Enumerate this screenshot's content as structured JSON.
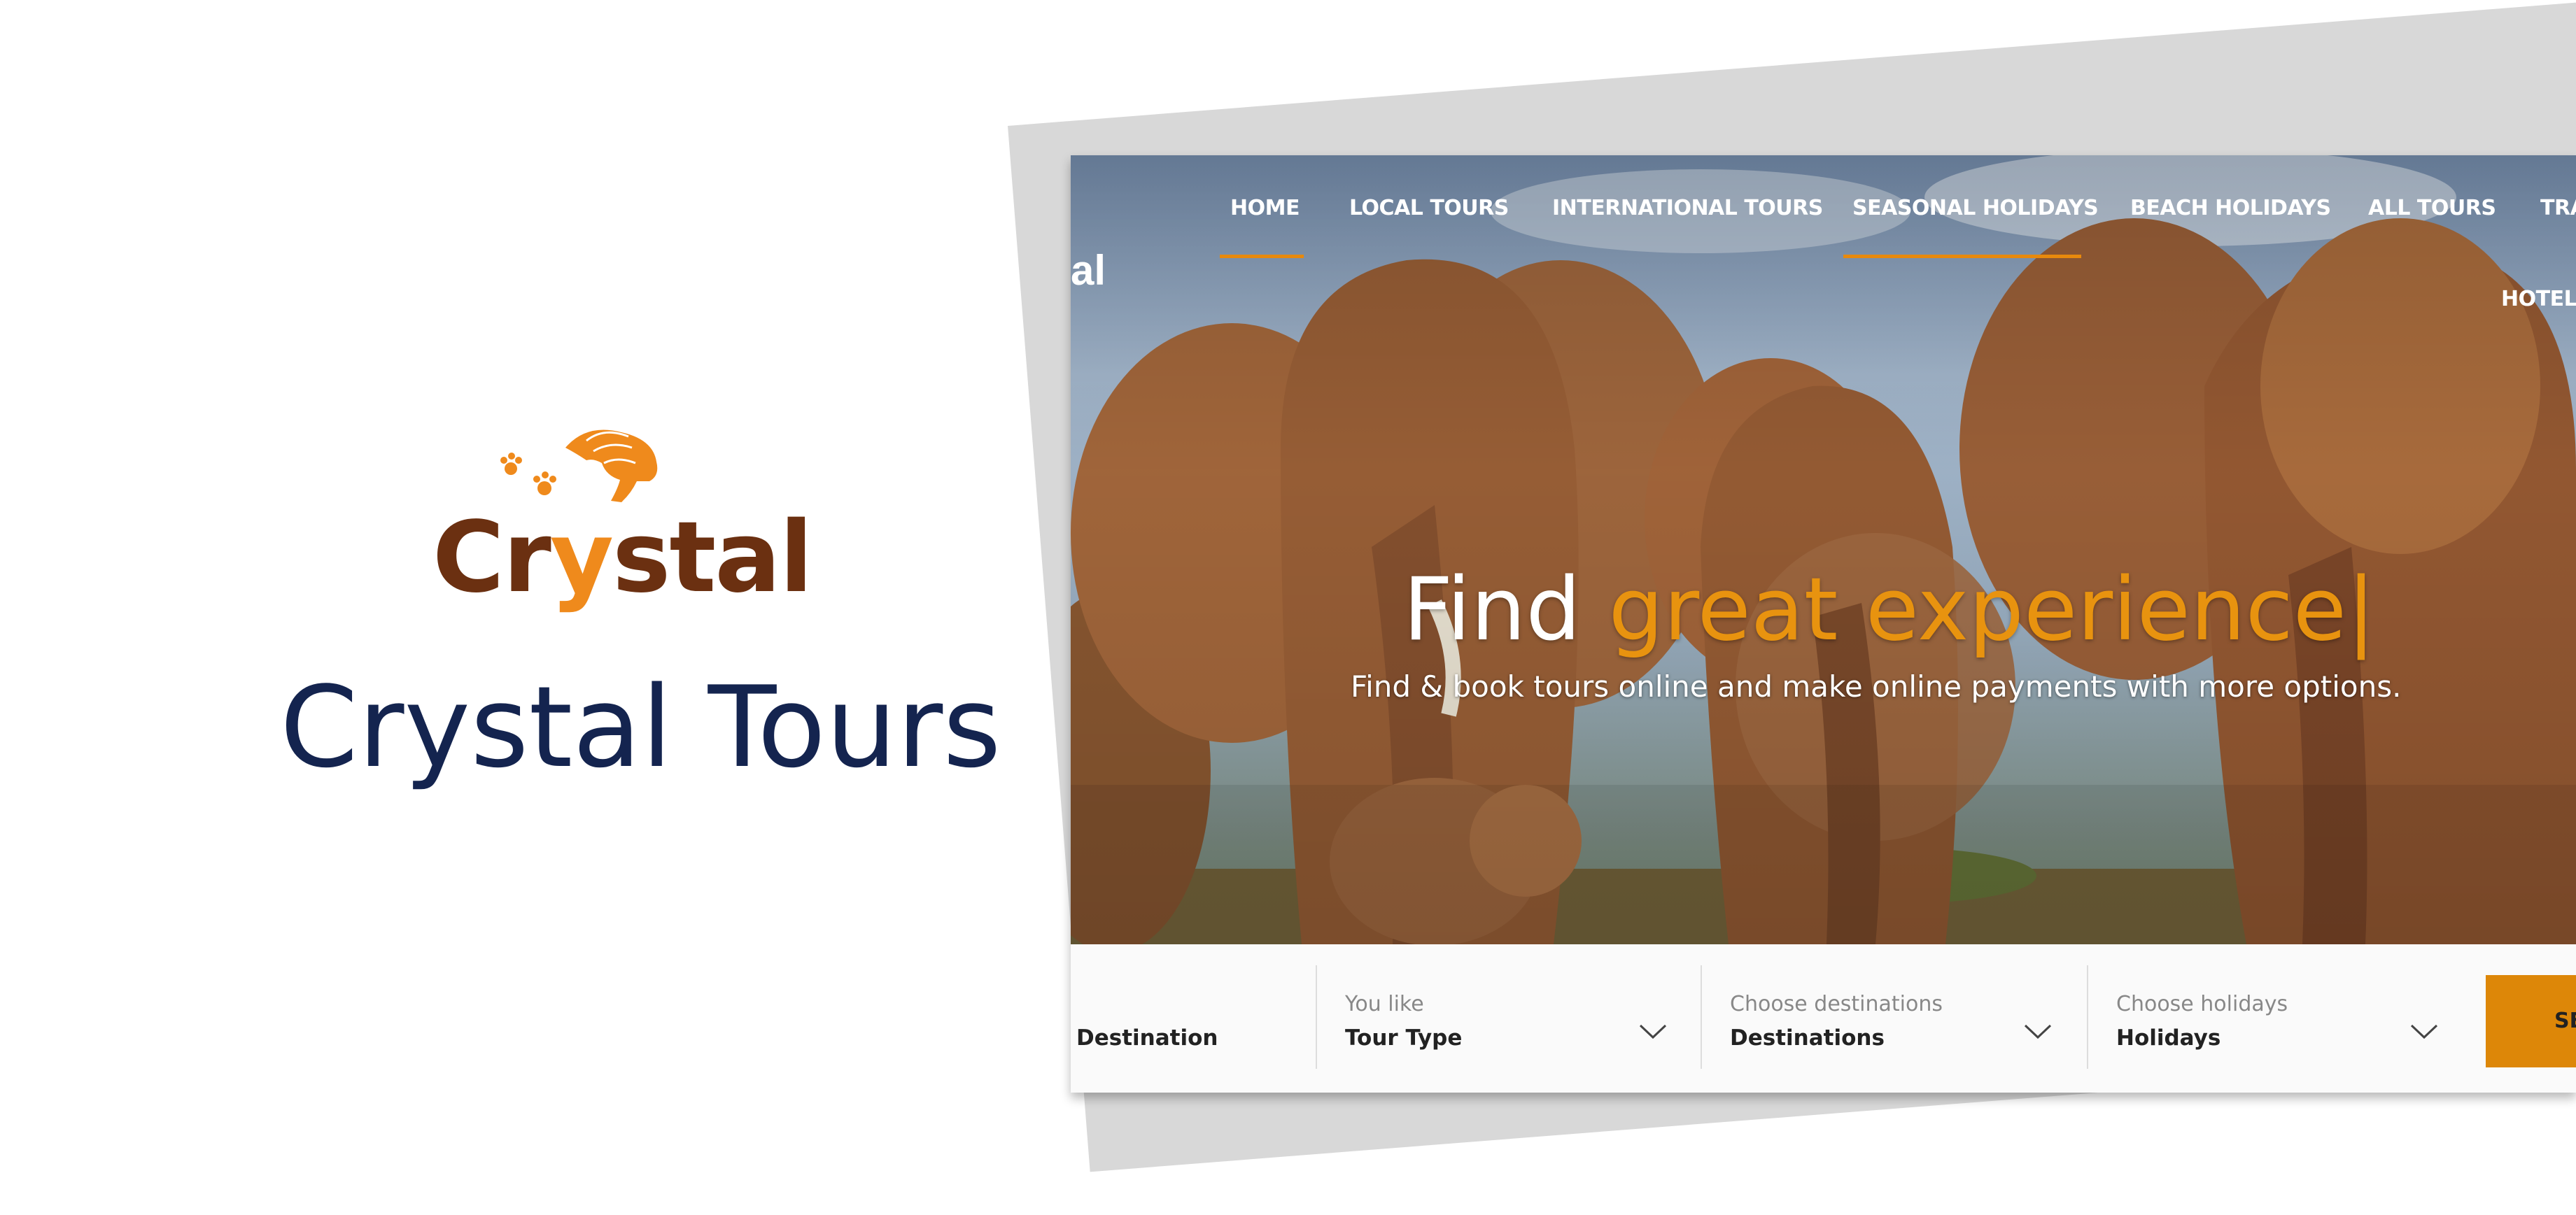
{
  "brand": {
    "logo_text_before": "Cr",
    "logo_text_y": "y",
    "logo_text_after": "stal",
    "title": "Crystal Tours",
    "colors": {
      "logo_brown": "#6b3011",
      "logo_orange": "#ef8a1c",
      "title_navy": "#14244f"
    },
    "logo_icon": "lion-head-with-paw-prints-icon"
  },
  "site": {
    "logo_fragment": "al",
    "nav": [
      {
        "label": "HOME",
        "active": true
      },
      {
        "label": "LOCAL TOURS"
      },
      {
        "label": "INTERNATIONAL TOURS"
      },
      {
        "label": "SEASONAL HOLIDAYS",
        "active": true
      },
      {
        "label": "BEACH HOLIDAYS"
      },
      {
        "label": "ALL TOURS"
      },
      {
        "label": "TRA"
      },
      {
        "label": "HOTELS"
      }
    ],
    "hero": {
      "headline_plain": "Find ",
      "headline_accent": "great experience",
      "caret": "|",
      "subline": "Find & book tours online and make online payments with more options.",
      "accent_color": "#e8930f"
    },
    "search": {
      "fields": [
        {
          "label": "",
          "value": "Destination"
        },
        {
          "label": "You like",
          "value": "Tour Type"
        },
        {
          "label": "Choose destinations",
          "value": "Destinations"
        },
        {
          "label": "Choose holidays",
          "value": "Holidays"
        }
      ],
      "button": "SE",
      "button_color": "#dd8708"
    }
  }
}
